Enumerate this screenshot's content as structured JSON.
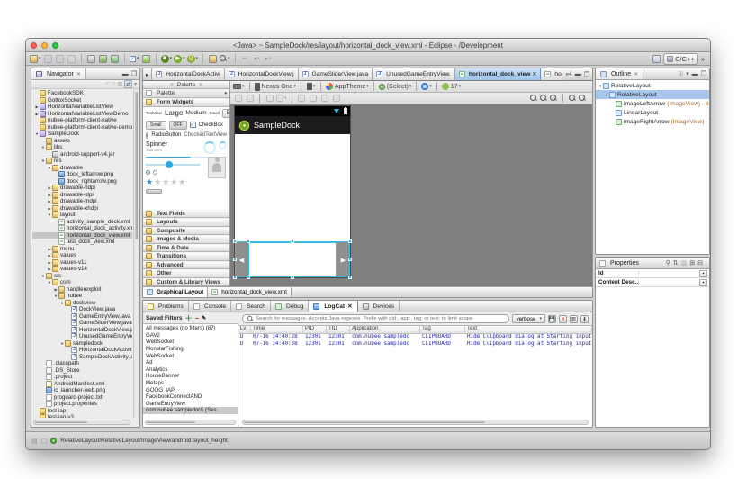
{
  "window": {
    "title": "<Java> ~ SampleDock/res/layout/horizontal_dock_view.xml - Eclipse - /Development",
    "perspective_label": "C/C++",
    "overflow_chevron": "»"
  },
  "navigator": {
    "title": "Navigator",
    "items": [
      {
        "label": "FacebookSDK",
        "icon": "folder",
        "depth": 0,
        "arrow": "none",
        "selected": false
      },
      {
        "label": "GottoxSocket",
        "icon": "folder",
        "depth": 0,
        "arrow": "none",
        "selected": false
      },
      {
        "label": "HorizontalVariableListView",
        "icon": "project",
        "depth": 0,
        "arrow": "collapsed",
        "selected": false
      },
      {
        "label": "HorizontalVariableListViewDemo",
        "icon": "project",
        "depth": 0,
        "arrow": "collapsed",
        "selected": false
      },
      {
        "label": "nubee-platform-client-native",
        "icon": "folder",
        "depth": 0,
        "arrow": "none",
        "selected": false
      },
      {
        "label": "nubee-platform-client-native-demo",
        "icon": "folder",
        "depth": 0,
        "arrow": "none",
        "selected": false
      },
      {
        "label": "SampleDock",
        "icon": "project",
        "depth": 0,
        "arrow": "expanded",
        "selected": false
      },
      {
        "label": "assets",
        "icon": "folder",
        "depth": 1,
        "arrow": "none",
        "selected": false
      },
      {
        "label": "libs",
        "icon": "folder",
        "depth": 1,
        "arrow": "expanded",
        "selected": false
      },
      {
        "label": "android-support-v4.jar",
        "icon": "jar",
        "depth": 2,
        "arrow": "none",
        "selected": false
      },
      {
        "label": "res",
        "icon": "folder",
        "depth": 1,
        "arrow": "expanded",
        "selected": false
      },
      {
        "label": "drawable",
        "icon": "folder",
        "depth": 2,
        "arrow": "expanded",
        "selected": false
      },
      {
        "label": "dock_leftarrow.png",
        "icon": "png",
        "depth": 3,
        "arrow": "none",
        "selected": false
      },
      {
        "label": "dock_rightarrow.png",
        "icon": "png",
        "depth": 3,
        "arrow": "none",
        "selected": false
      },
      {
        "label": "drawable-hdpi",
        "icon": "folder",
        "depth": 2,
        "arrow": "collapsed",
        "selected": false
      },
      {
        "label": "drawable-ldpi",
        "icon": "folder",
        "depth": 2,
        "arrow": "collapsed",
        "selected": false
      },
      {
        "label": "drawable-mdpi",
        "icon": "folder",
        "depth": 2,
        "arrow": "collapsed",
        "selected": false
      },
      {
        "label": "drawable-xhdpi",
        "icon": "folder",
        "depth": 2,
        "arrow": "collapsed",
        "selected": false
      },
      {
        "label": "layout",
        "icon": "folder",
        "depth": 2,
        "arrow": "expanded",
        "selected": false
      },
      {
        "label": "activity_sample_dock.xml",
        "icon": "xml",
        "depth": 3,
        "arrow": "none",
        "selected": false
      },
      {
        "label": "horizontal_dock_activity.xml",
        "icon": "xml",
        "depth": 3,
        "arrow": "none",
        "selected": false
      },
      {
        "label": "horizontal_dock_view.xml",
        "icon": "xml",
        "depth": 3,
        "arrow": "none",
        "selected": true
      },
      {
        "label": "test_dock_view.xml",
        "icon": "xml",
        "depth": 3,
        "arrow": "none",
        "selected": false
      },
      {
        "label": "menu",
        "icon": "folder",
        "depth": 2,
        "arrow": "collapsed",
        "selected": false
      },
      {
        "label": "values",
        "icon": "folder",
        "depth": 2,
        "arrow": "collapsed",
        "selected": false
      },
      {
        "label": "values-v11",
        "icon": "folder",
        "depth": 2,
        "arrow": "collapsed",
        "selected": false
      },
      {
        "label": "values-v14",
        "icon": "folder",
        "depth": 2,
        "arrow": "collapsed",
        "selected": false
      },
      {
        "label": "src",
        "icon": "folder",
        "depth": 1,
        "arrow": "expanded",
        "selected": false
      },
      {
        "label": "com",
        "icon": "folder",
        "depth": 2,
        "arrow": "expanded",
        "selected": false
      },
      {
        "label": "handlerexploit",
        "icon": "folder",
        "depth": 3,
        "arrow": "collapsed",
        "selected": false
      },
      {
        "label": "nubee",
        "icon": "folder",
        "depth": 3,
        "arrow": "expanded",
        "selected": false
      },
      {
        "label": "dockview",
        "icon": "folder",
        "depth": 4,
        "arrow": "expanded",
        "selected": false
      },
      {
        "label": "DockView.java",
        "icon": "java",
        "depth": 5,
        "arrow": "none",
        "selected": false
      },
      {
        "label": "GameEntryView.java",
        "icon": "java",
        "depth": 5,
        "arrow": "none",
        "selected": false
      },
      {
        "label": "GameSliderView.java",
        "icon": "java",
        "depth": 5,
        "arrow": "none",
        "selected": false
      },
      {
        "label": "HorizontalDockView.java",
        "icon": "java",
        "depth": 5,
        "arrow": "none",
        "selected": false
      },
      {
        "label": "UnusedGameEntryView.ja",
        "icon": "java",
        "depth": 5,
        "arrow": "none",
        "selected": false
      },
      {
        "label": "sampledock",
        "icon": "folder",
        "depth": 4,
        "arrow": "expanded",
        "selected": false
      },
      {
        "label": "HorizontalDockActivity.ja",
        "icon": "java",
        "depth": 5,
        "arrow": "none",
        "selected": false
      },
      {
        "label": "SampleDockActivity.java",
        "icon": "java",
        "depth": 5,
        "arrow": "none",
        "selected": false
      },
      {
        "label": ".classpath",
        "icon": "file",
        "depth": 1,
        "arrow": "none",
        "selected": false
      },
      {
        "label": ".DS_Store",
        "icon": "file",
        "depth": 1,
        "arrow": "none",
        "selected": false
      },
      {
        "label": ".project",
        "icon": "file",
        "depth": 1,
        "arrow": "none",
        "selected": false
      },
      {
        "label": "AndroidManifest.xml",
        "icon": "manifest",
        "depth": 1,
        "arrow": "none",
        "selected": false
      },
      {
        "label": "ic_launcher-web.png",
        "icon": "png",
        "depth": 1,
        "arrow": "none",
        "selected": false
      },
      {
        "label": "proguard-project.txt",
        "icon": "file",
        "depth": 1,
        "arrow": "none",
        "selected": false
      },
      {
        "label": "project.properties",
        "icon": "file",
        "depth": 1,
        "arrow": "none",
        "selected": false
      },
      {
        "label": "test-iap",
        "icon": "folder",
        "depth": 0,
        "arrow": "none",
        "selected": false
      },
      {
        "label": "test-iap-v3",
        "icon": "folder",
        "depth": 0,
        "arrow": "none",
        "selected": false
      }
    ]
  },
  "editor": {
    "tabs": [
      {
        "label": "HorizontalDockActivi",
        "icon": "java",
        "active": false
      },
      {
        "label": "HorizontalDockView.j",
        "icon": "java",
        "active": false
      },
      {
        "label": "GameSliderView.java",
        "icon": "java",
        "active": false
      },
      {
        "label": "UnusedGameEntryView.",
        "icon": "java",
        "active": false
      },
      {
        "label": "horizontal_dock_view",
        "icon": "xml",
        "active": true
      },
      {
        "label": "horizontal_dock_acti",
        "icon": "xml",
        "active": false
      }
    ],
    "overflow_count": "4"
  },
  "palette": {
    "tab_title": "Palette",
    "header": "Palette",
    "form_widgets": "Form Widgets",
    "widgets": {
      "textview": "TextView",
      "large": "Large",
      "medium": "Medium",
      "small": "Small",
      "button": "Button",
      "small_btn": "Small",
      "off": "OFF",
      "checkbox": "CheckBox",
      "radiobutton": "RadioButton",
      "checkedtextview": "CheckedTextView",
      "spinner": "Spinner",
      "subitem": "Sub Item"
    },
    "sections": [
      "Text Fields",
      "Layouts",
      "Composite",
      "Images & Media",
      "Time & Date",
      "Transitions",
      "Advanced",
      "Other",
      "Custom & Library Views"
    ],
    "bottom_tabs": [
      {
        "label": "Graphical Layout",
        "active": true
      },
      {
        "label": "horizontal_dock_view.xml",
        "active": false
      }
    ]
  },
  "layout_config": {
    "device": "Nexus One",
    "theme": "AppTheme",
    "select": "(Select)",
    "api": "17"
  },
  "preview": {
    "app_title": "SampleDock"
  },
  "outline": {
    "title": "Outline",
    "items": [
      {
        "label": "RelativeLayout",
        "detail": "",
        "icon": "layout",
        "depth": 0,
        "arrow": "expanded",
        "selected": false
      },
      {
        "label": "RelativeLayout",
        "detail": "",
        "icon": "layout",
        "depth": 1,
        "arrow": "expanded",
        "selected": true
      },
      {
        "label": "imageLeftArrow",
        "detail": "(ImageView) - dock_l",
        "icon": "image",
        "depth": 2,
        "arrow": "none",
        "selected": false
      },
      {
        "label": "LinearLayout",
        "detail": "",
        "icon": "layout2",
        "depth": 2,
        "arrow": "none",
        "selected": false
      },
      {
        "label": "imageRightArrow",
        "detail": "(ImageView) - dock",
        "icon": "image",
        "depth": 2,
        "arrow": "none",
        "selected": false
      }
    ]
  },
  "properties": {
    "title": "Properties",
    "rows": [
      {
        "name": "Id",
        "value": ""
      },
      {
        "name": "Content Desc...",
        "value": ""
      }
    ]
  },
  "console": {
    "tabs": [
      {
        "label": "Problems",
        "active": false
      },
      {
        "label": "Console",
        "active": false
      },
      {
        "label": "Search",
        "active": false
      },
      {
        "label": "Debug",
        "active": false
      },
      {
        "label": "LogCat",
        "active": true
      },
      {
        "label": "Devices",
        "active": false
      }
    ],
    "saved_filters_label": "Saved Filters",
    "filters": [
      {
        "label": "All messages (no filters) (87)",
        "selected": false
      },
      {
        "label": "GAV2",
        "selected": false
      },
      {
        "label": "WebSocket",
        "selected": false
      },
      {
        "label": "MonstarFishing",
        "selected": false
      },
      {
        "label": "WebSocket",
        "selected": false
      },
      {
        "label": "Ad",
        "selected": false
      },
      {
        "label": "Analytics",
        "selected": false
      },
      {
        "label": "HouseBanner",
        "selected": false
      },
      {
        "label": "Metaps",
        "selected": false
      },
      {
        "label": "GOOG_IAP",
        "selected": false
      },
      {
        "label": "FacebookConnectAND",
        "selected": false
      },
      {
        "label": "GameEntryView",
        "selected": false
      },
      {
        "label": "com.nubee.sampledock (Ses",
        "selected": true
      }
    ],
    "search_placeholder": "Search for messages. Accepts Java regexes. Prefix with pid:, app:, tag: or text: to limit scope.",
    "level": "verbose",
    "columns": [
      "Lv",
      "Time",
      "PID",
      "TID",
      "Application",
      "Tag",
      "Text"
    ],
    "rows": [
      {
        "level": "D",
        "time": "07-16 14:40:28",
        "pid": "12301",
        "tid": "12301",
        "app": "com.nubee.sampledc",
        "tag": "CLIPBOARD",
        "text": "Hide Clipboard dialog at Starting input: finished by someone else... !"
      },
      {
        "level": "D",
        "time": "07-16 14:40:38",
        "pid": "12301",
        "tid": "12301",
        "app": "com.nubee.sampledc",
        "tag": "CLIPBOARD",
        "text": "Hide Clipboard dialog at Starting input: finished by someone else... !"
      }
    ]
  },
  "statusbar": {
    "path": "RelativeLayout/RelativeLayout/ImageView/android:layout_height"
  }
}
